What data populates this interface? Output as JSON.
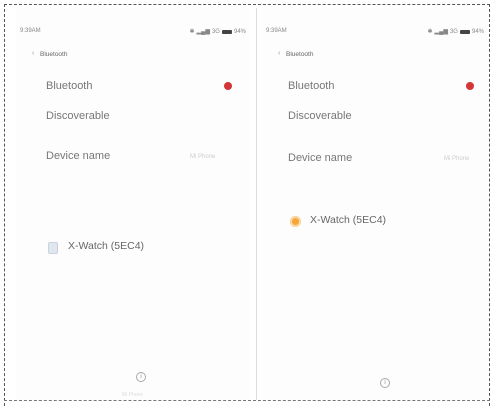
{
  "left_phone": {
    "status": {
      "time": "9:39AM",
      "network": "3G",
      "battery": "94%"
    },
    "title": "Bluetooth",
    "rows": {
      "bluetooth": "Bluetooth",
      "discoverable": "Discoverable",
      "device_name": "Device name",
      "device_name_value": "Mi Phone"
    },
    "device": {
      "name": "X-Watch (5EC4)"
    },
    "footer_caption": "Mi Phone"
  },
  "right_phone": {
    "status": {
      "time": "9:39AM",
      "network": "3G",
      "battery": "94%"
    },
    "title": "Bluetooth",
    "rows": {
      "bluetooth": "Bluetooth",
      "discoverable": "Discoverable",
      "device_name": "Device name",
      "device_name_value": "Mi Phone"
    },
    "device": {
      "name": "X-Watch (5EC4)"
    }
  },
  "colors": {
    "toggle_on": "#d23636",
    "device_connecting": "#f6a73a"
  },
  "icons": {
    "back": "chevron-left-icon",
    "info": "info-icon",
    "device_left": "watch-icon",
    "device_right": "connecting-spinner-icon",
    "signal": "signal-icon",
    "battery": "battery-icon",
    "bluetooth_status": "bluetooth-icon"
  }
}
